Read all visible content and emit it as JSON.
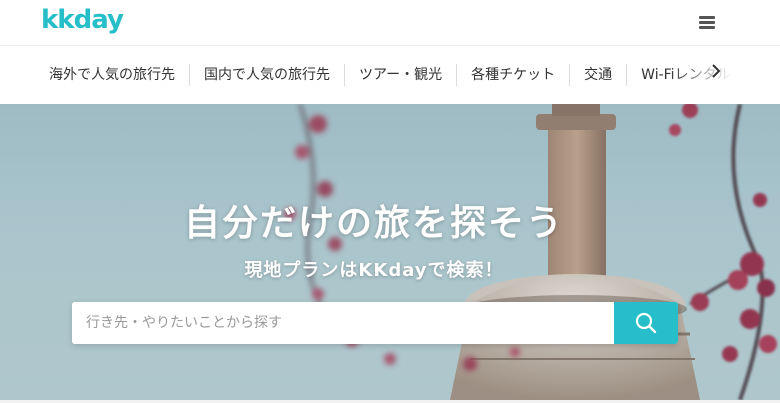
{
  "header": {
    "logo_text": "kkday",
    "brand_color": "#26bec9",
    "menu_icon": "hamburger-menu-icon"
  },
  "nav": {
    "items": [
      {
        "label": "海外で人気の旅行先"
      },
      {
        "label": "国内で人気の旅行先"
      },
      {
        "label": "ツアー・観光"
      },
      {
        "label": "各種チケット"
      },
      {
        "label": "交通"
      },
      {
        "label": "Wi-Fiレンタル"
      }
    ],
    "next_icon": "chevron-right-icon"
  },
  "hero": {
    "title": "自分だけの旅を探そう",
    "subtitle": "現地プランはKKdayで検索！",
    "search": {
      "placeholder": "行き先・やりたいことから探す",
      "value": "",
      "button_icon": "search-icon",
      "button_color": "#26bec9"
    }
  }
}
